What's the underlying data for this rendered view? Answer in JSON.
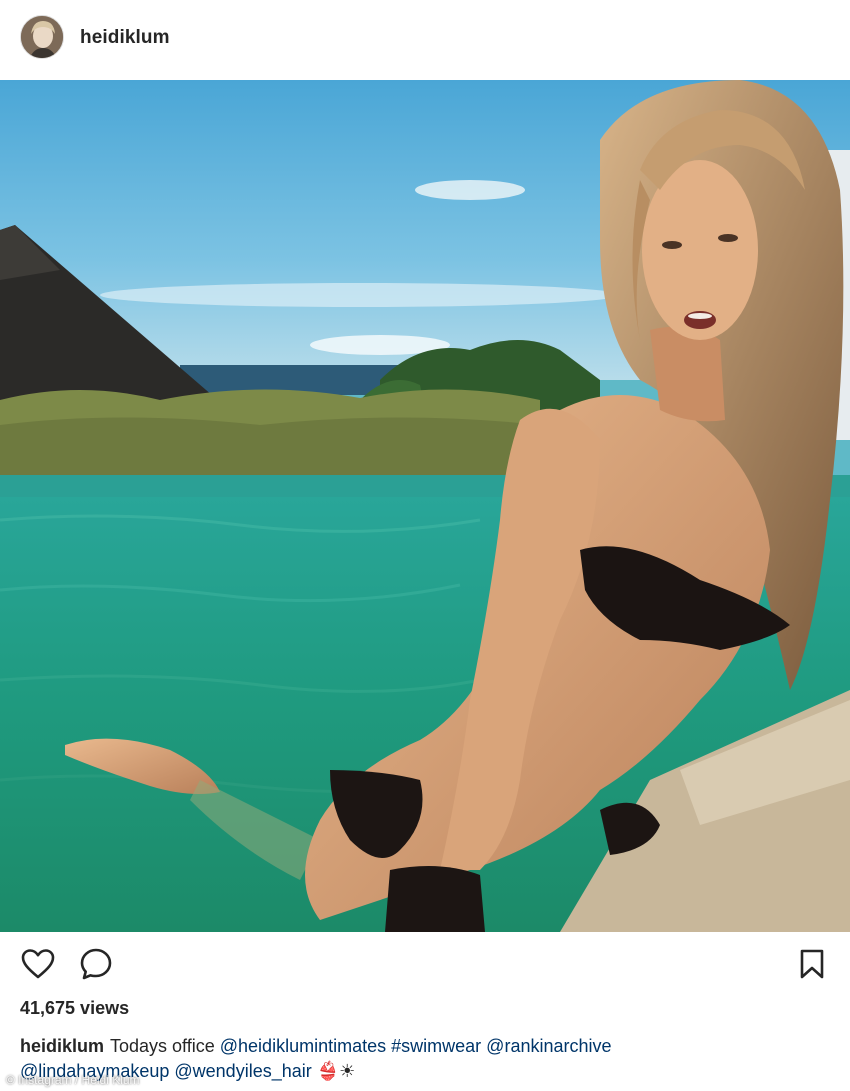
{
  "header": {
    "username": "heidiklum",
    "avatar_icon": "profile-avatar"
  },
  "photo": {
    "description_icon": "post-photo"
  },
  "actions": {
    "like_icon": "heart-icon",
    "comment_icon": "comment-bubble-icon",
    "save_icon": "bookmark-icon"
  },
  "stats": {
    "views": "41,675 views"
  },
  "caption": {
    "user": "heidiklum",
    "text": "Todays office",
    "mention1": "@heidiklumintimates",
    "hashtag": "#swimwear",
    "mention2": "@rankinarchive",
    "mention3": "@lindahaymakeup",
    "mention4": "@wendyiles_hair",
    "emoji": "👙☀"
  },
  "watermark": "© Instagram / Heidi Klum",
  "colors": {
    "text": "#262626",
    "link": "#003569",
    "border": "#dbdbdb"
  }
}
